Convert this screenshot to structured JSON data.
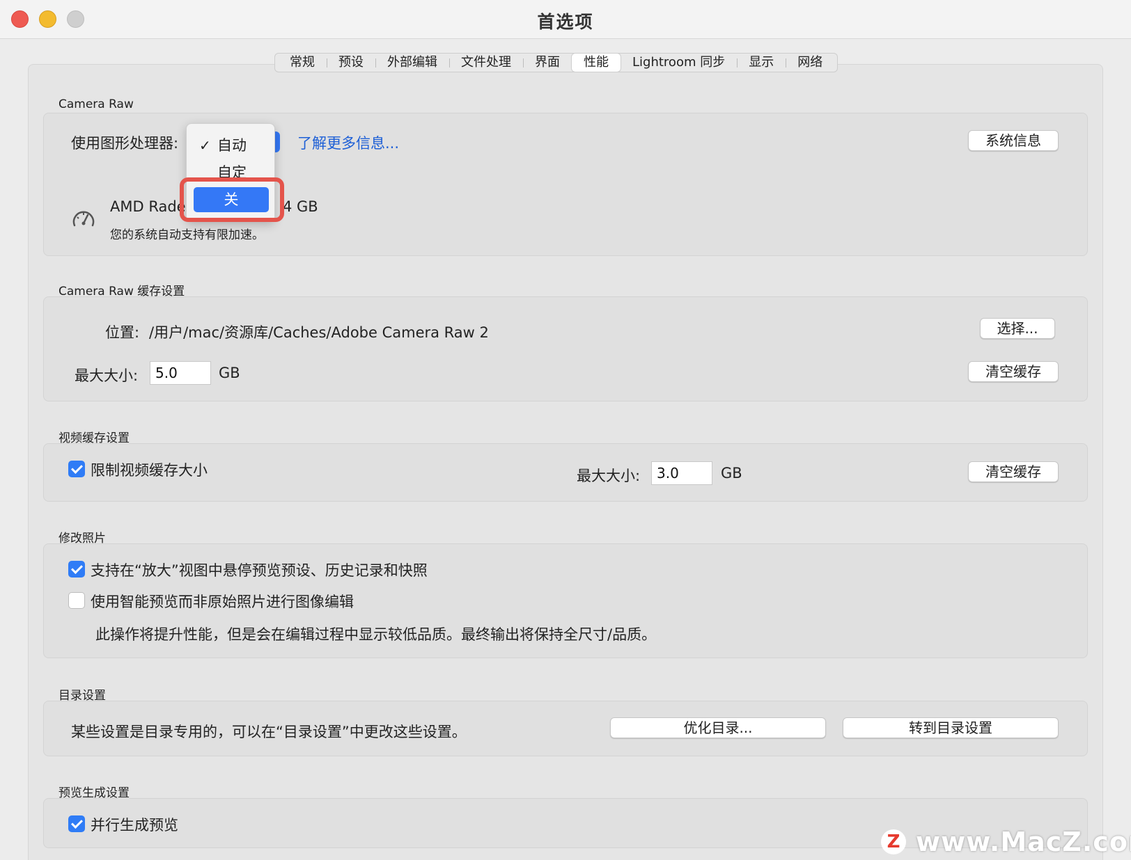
{
  "window": {
    "title": "首选项"
  },
  "tabs": [
    {
      "label": "常规",
      "active": false
    },
    {
      "label": "预设",
      "active": false
    },
    {
      "label": "外部编辑",
      "active": false
    },
    {
      "label": "文件处理",
      "active": false
    },
    {
      "label": "界面",
      "active": false
    },
    {
      "label": "性能",
      "active": true
    },
    {
      "label": "Lightroom 同步",
      "active": false
    },
    {
      "label": "显示",
      "active": false
    },
    {
      "label": "网络",
      "active": false
    }
  ],
  "camera_raw": {
    "section_label": "Camera Raw",
    "gpu_label": "使用图形处理器:",
    "learn_more": "了解更多信息...",
    "system_info_button": "系统信息",
    "gpu_name": "AMD Rade",
    "gpu_memory": "4 GB",
    "gpu_status": "您的系统自动支持有限加速。",
    "dropdown": {
      "options": [
        "自动",
        "自定",
        "关"
      ],
      "checked": "自动",
      "highlighted": "关"
    }
  },
  "cache": {
    "section_label": "Camera Raw 缓存设置",
    "location_label": "位置:",
    "location_value": "/用户/mac/资源库/Caches/Adobe Camera Raw 2",
    "choose_button": "选择...",
    "max_size_label": "最大大小:",
    "max_size_value": "5.0",
    "unit": "GB",
    "clear_button": "清空缓存"
  },
  "video_cache": {
    "section_label": "视频缓存设置",
    "limit_label": "限制视频缓存大小",
    "limit_checked": true,
    "max_size_label": "最大大小:",
    "max_size_value": "3.0",
    "unit": "GB",
    "clear_button": "清空缓存"
  },
  "develop": {
    "section_label": "修改照片",
    "option1": "支持在“放大”视图中悬停预览预设、历史记录和快照",
    "option1_checked": true,
    "option2": "使用智能预览而非原始照片进行图像编辑",
    "option2_checked": false,
    "note": "此操作将提升性能，但是会在编辑过程中显示较低品质。最终输出将保持全尺寸/品质。"
  },
  "catalog": {
    "section_label": "目录设置",
    "description": "某些设置是目录专用的，可以在“目录设置”中更改这些设置。",
    "optimize_button": "优化目录...",
    "goto_button": "转到目录设置"
  },
  "preview": {
    "section_label": "预览生成设置",
    "parallel_label": "并行生成预览",
    "parallel_checked": true
  },
  "watermark": {
    "logo": "Z",
    "text": "www.MacZ.com"
  },
  "colors": {
    "accent": "#3478f6",
    "highlight_box": "#e4544b",
    "link": "#1d5fd6"
  }
}
